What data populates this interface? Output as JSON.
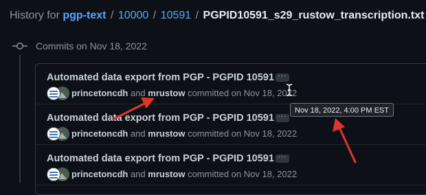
{
  "header": {
    "prefix": "History for",
    "repo": "pgp-text",
    "sep": "/",
    "crumbs": [
      "10000",
      "10591"
    ],
    "filename": "PGPID10591_s29_rustow_transcription.txt"
  },
  "timeline": {
    "heading": "Commits on Nov 18, 2022"
  },
  "commits": [
    {
      "title": "Automated data export from PGP - PGPID 10591",
      "more": "···",
      "author1": "princetoncdh",
      "and": "and",
      "author2": "mrustow",
      "action": "committed on Nov 18, 2022"
    },
    {
      "title": "Automated data export from PGP - PGPID 10591",
      "more": "···",
      "author1": "princetoncdh",
      "and": "and",
      "author2": "mrustow",
      "action": "committed on Nov 18, 2022"
    },
    {
      "title": "Automated data export from PGP - PGPID 10591",
      "more": "···",
      "author1": "princetoncdh",
      "and": "and",
      "author2": "mrustow",
      "action": "committed on Nov 18, 2022"
    }
  ],
  "tooltip": {
    "text": "Nov 18, 2022, 4:00 PM EST"
  },
  "annotation_color": "#e0352b",
  "icons": {
    "commit_group": "git-commit-icon",
    "cursor": "text-cursor-icon"
  }
}
